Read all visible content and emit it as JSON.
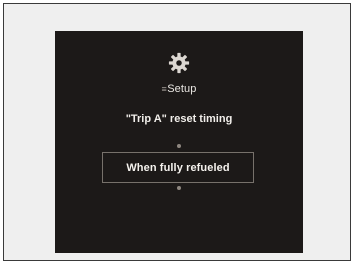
{
  "breadcrumb": {
    "prefix": "≡",
    "label": "Setup"
  },
  "setting": {
    "title": "\"Trip A\" reset timing",
    "selected_option": "When fully refueled"
  },
  "icons": {
    "header": "gear-icon",
    "scroll_up": "up-arrow-icon",
    "scroll_down": "down-arrow-icon"
  }
}
